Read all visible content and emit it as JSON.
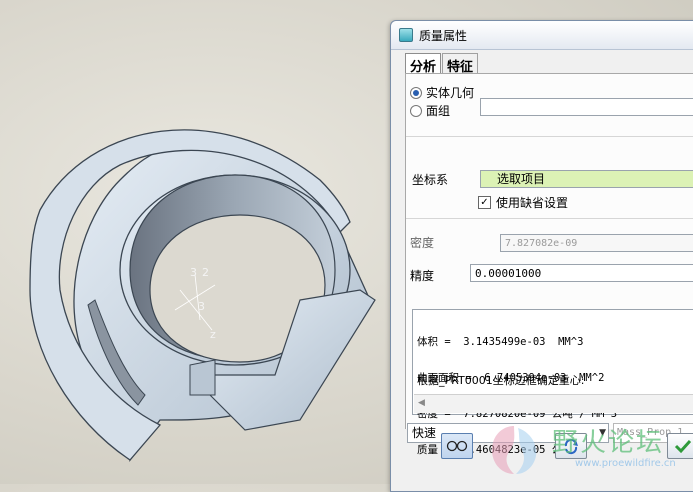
{
  "dialog": {
    "title": "质量属性",
    "tabs": [
      {
        "label": "分析",
        "active": true
      },
      {
        "label": "特征",
        "active": false
      }
    ],
    "geometry_options": [
      {
        "label": "实体几何",
        "selected": true
      },
      {
        "label": "面组",
        "selected": false
      }
    ],
    "quilt_value": "",
    "csys": {
      "label": "坐标系",
      "selector_text": "选取项目",
      "use_default_label": "使用缺省设置",
      "use_default_checked": true
    },
    "density": {
      "label": "密度",
      "value": "7.827082e-09"
    },
    "accuracy": {
      "label": "精度",
      "value": "0.00001000"
    },
    "results": {
      "line1": "体积 =  3.1435499e-03  MM^3",
      "line2": "曲面面积 =  6.7405394e-03  MM^2",
      "line3": "密度 =  7.8270820e-09 公吨 / MM^3",
      "line4": "质量 =  2.4604823e-05 公吨",
      "note": "根据_PRT0001坐标边框确定重心:"
    },
    "mode_combo": "快速",
    "name_field_placeholder": "Mass_Prop_1"
  },
  "model": {
    "csys_labels": [
      "3",
      "2",
      "3",
      "z"
    ]
  },
  "watermark": {
    "text": "野火论坛",
    "url": "www.proewildfire.cn"
  },
  "colors": {
    "part_fill": "#c9d6e4",
    "part_edge": "#3b4652",
    "selector_bg": "#dcf2b5",
    "ok_check": "#2e9a3a"
  }
}
